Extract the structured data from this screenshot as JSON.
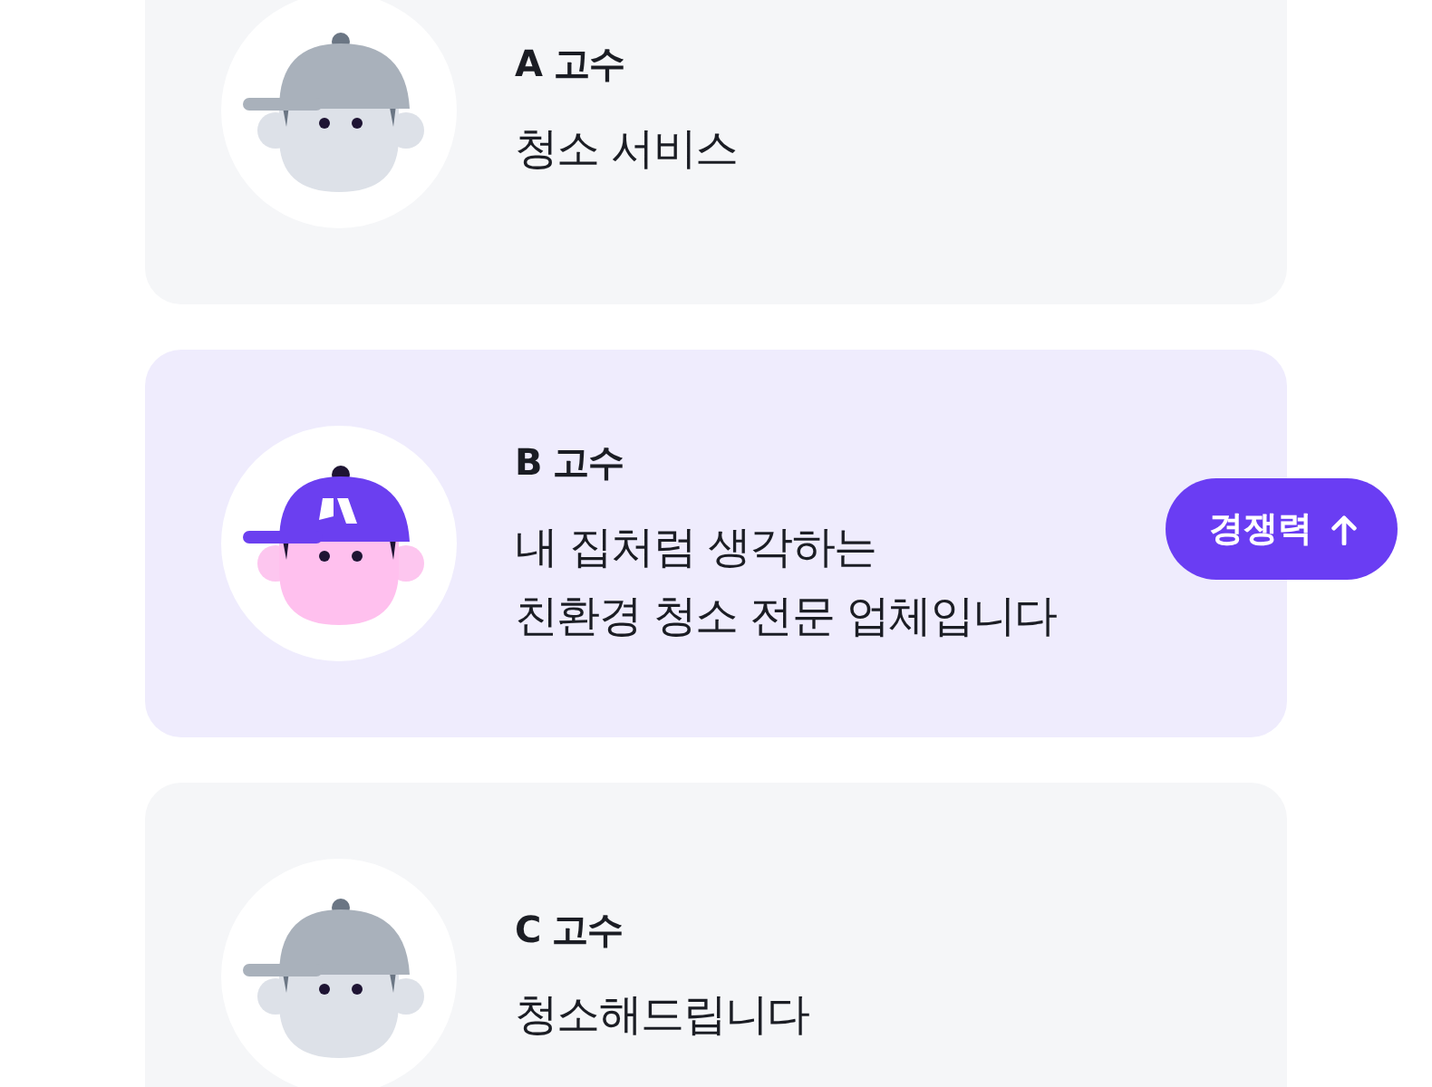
{
  "experts": [
    {
      "name": "A 고수",
      "description": [
        "청소 서비스"
      ],
      "highlighted": false
    },
    {
      "name": "B 고수",
      "description": [
        "내 집처럼 생각하는",
        "친환경 청소 전문 업체입니다"
      ],
      "highlighted": true,
      "badge": "경쟁력"
    },
    {
      "name": "C 고수",
      "description": [
        "청소해드립니다"
      ],
      "highlighted": false
    }
  ]
}
